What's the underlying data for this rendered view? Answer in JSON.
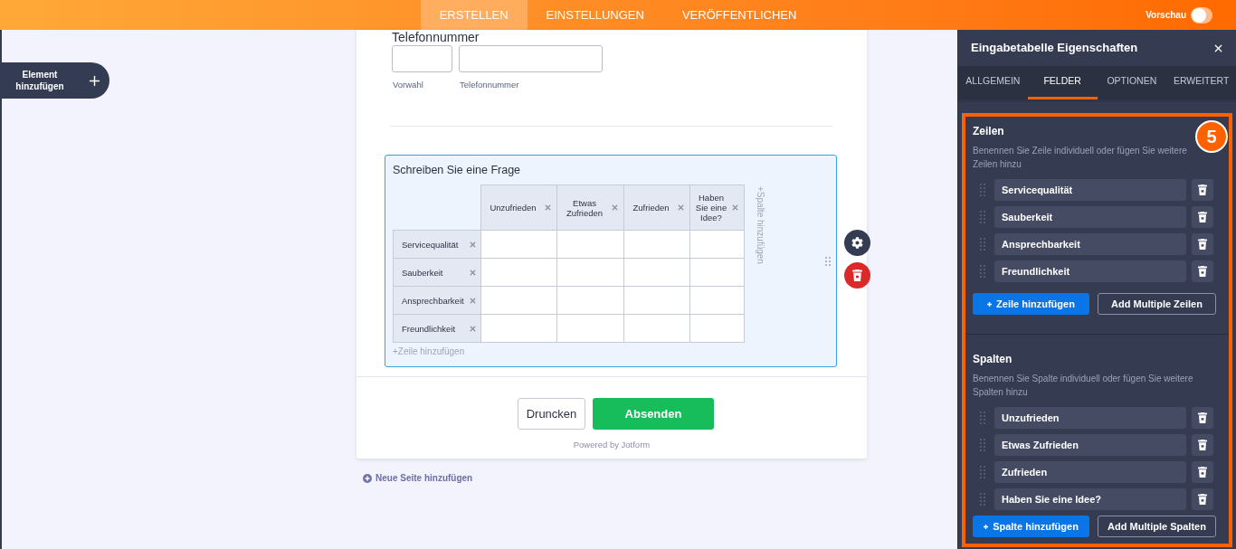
{
  "top_bar": {
    "tabs": [
      {
        "label": "ERSTELLEN",
        "selected": true
      },
      {
        "label": "EINSTELLUNGEN",
        "selected": false
      },
      {
        "label": "VERÖFFENTLICHEN",
        "selected": false
      }
    ],
    "preview": {
      "label": "Vorschau",
      "on": false
    }
  },
  "add_element_button": {
    "label": "Element hinzufügen"
  },
  "form": {
    "phone_field": {
      "label": "Telefonnummer",
      "inputs": [
        {
          "sublabel": "Vorwahl"
        },
        {
          "sublabel": "Telefonnummer"
        }
      ]
    },
    "input_table": {
      "question": "Schreiben Sie eine Frage",
      "columns": [
        "Unzufrieden",
        "Etwas Zufrieden",
        "Zufrieden",
        "Haben Sie eine Idee?"
      ],
      "rows": [
        "Servicequalität",
        "Sauberkeit",
        "Ansprechbarkeit",
        "Freundlichkeit"
      ],
      "add_row": "+Zeile hinzufügen",
      "add_column": "+Spalte hinzufügen"
    },
    "buttons": [
      {
        "label": "Druncken",
        "kind": "secondary"
      },
      {
        "label": "Absenden",
        "kind": "primary"
      }
    ],
    "footer": "Powered by Jotform"
  },
  "add_page_link": "Neue Seite hinzufügen",
  "properties_panel": {
    "title": "Eingabetabelle Eigenschaften",
    "tabs": [
      {
        "label": "ALLGEMEIN",
        "selected": false
      },
      {
        "label": "FELDER",
        "selected": true
      },
      {
        "label": "OPTIONEN",
        "selected": false
      },
      {
        "label": "ERWEITERT",
        "selected": false
      }
    ],
    "sections": [
      {
        "title": "Zeilen",
        "description": "Benennen Sie Zeile individuell oder fügen Sie weitere Zeilen hinzu",
        "items": [
          "Servicequalität",
          "Sauberkeit",
          "Ansprechbarkeit",
          "Freundlichkeit"
        ],
        "add_button": "Zeile hinzufügen",
        "multiple_button": "Add Multiple Zeilen"
      },
      {
        "title": "Spalten",
        "description": "Benennen Sie Spalte individuell oder fügen Sie weitere Spalten hinzu",
        "items": [
          "Unzufrieden",
          "Etwas Zufrieden",
          "Zufrieden",
          "Haben Sie eine Idee?"
        ],
        "add_button": "Spalte hinzufügen",
        "multiple_button": "Add Multiple Spalten"
      }
    ]
  },
  "step_badge": "5"
}
